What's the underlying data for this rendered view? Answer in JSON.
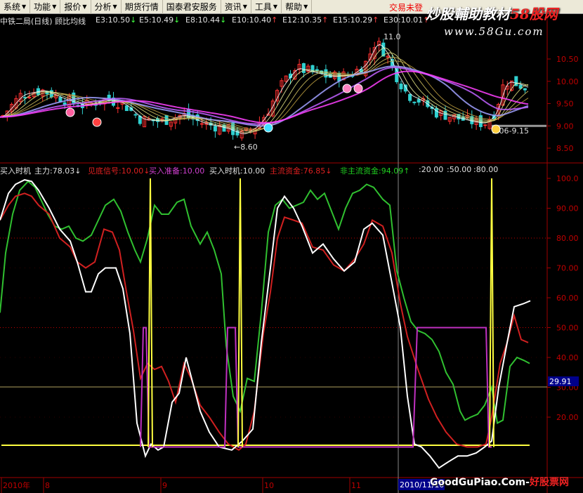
{
  "menu": {
    "items": [
      {
        "label": "系统",
        "arrow": "▼"
      },
      {
        "label": "功能",
        "arrow": "▼"
      },
      {
        "label": "报价",
        "arrow": "▼"
      },
      {
        "label": "分析",
        "arrow": "▼"
      },
      {
        "label": "期货行情",
        "arrow": ""
      },
      {
        "label": "国泰君安服务",
        "arrow": ""
      },
      {
        "label": "资讯",
        "arrow": "▼"
      },
      {
        "label": "工具",
        "arrow": "▼"
      },
      {
        "label": "帮助",
        "arrow": "▼"
      }
    ],
    "trade_status": "交易未登"
  },
  "price_header": {
    "stock_title": "中铁二局(日线) 顾比均线",
    "ema_values": [
      {
        "label": "E3:10.50",
        "arrow": "↓"
      },
      {
        "label": "E5:10.49",
        "arrow": "↓"
      },
      {
        "label": "E8:10.44",
        "arrow": "↓"
      },
      {
        "label": "E10:10.40",
        "arrow": "↑"
      },
      {
        "label": "E12:10.35",
        "arrow": "↑"
      },
      {
        "label": "E15:10.29",
        "arrow": "↑"
      },
      {
        "label": "E30:10.01",
        "arrow": "↑"
      }
    ]
  },
  "watermark": {
    "text_white": "炒股輔助教材",
    "text_red": "58股网",
    "url": "www.58Gu.com"
  },
  "price_chart": {
    "y_ticks": [
      "10.50",
      "10.00",
      "9.50",
      "9.00",
      "8.50"
    ],
    "annotations": {
      "low_label": "←8.60",
      "high_label": "11.0",
      "range_label": "9.06-9.15"
    }
  },
  "indicator_header": {
    "items": [
      {
        "label": "买入时机",
        "color": "#e0e0e0"
      },
      {
        "label": "主力:78.03",
        "arrow": "↓",
        "color": "#e0e0e0"
      },
      {
        "label": "见底信号:10.00",
        "arrow": "↓",
        "color": "#e02020"
      },
      {
        "label": "买入准备:10.00",
        "color": "#d040d0"
      },
      {
        "label": "买入时机:10.00",
        "color": "#e0e0e0"
      },
      {
        "label": "主流资金:76.85",
        "arrow": "↓",
        "color": "#e02020"
      },
      {
        "label": "非主流资金:94.09",
        "arrow": "↑",
        "color": "#20d020"
      },
      {
        "label": ":20.00",
        "color": "#e0e0e0"
      },
      {
        "label": ":50.00",
        "color": "#e0e0e0"
      },
      {
        "label": ":80.00",
        "color": "#e0e0e0"
      }
    ]
  },
  "indicator_chart": {
    "y_ticks": [
      "100.0",
      "90.00",
      "80.00",
      "70.00",
      "60.00",
      "50.00",
      "40.00",
      "30.00",
      "20.00"
    ],
    "current_value": "29.91"
  },
  "time_axis": {
    "labels": [
      "2010年",
      "8",
      "9",
      "10",
      "11"
    ],
    "cursor_date": "2010/11/10"
  },
  "bottom_watermark": {
    "text": "GoodGuPiao.Com-",
    "text_red": "好股票网"
  },
  "colors": {
    "bull_candle": "#ff3030",
    "bear_candle": "#30d0d0",
    "white_line": "#ffffff",
    "red_line": "#d02020",
    "green_line": "#30c030",
    "yellow_line": "#ffff40",
    "magenta_line": "#c030c0",
    "axis_red": "#c00000"
  }
}
